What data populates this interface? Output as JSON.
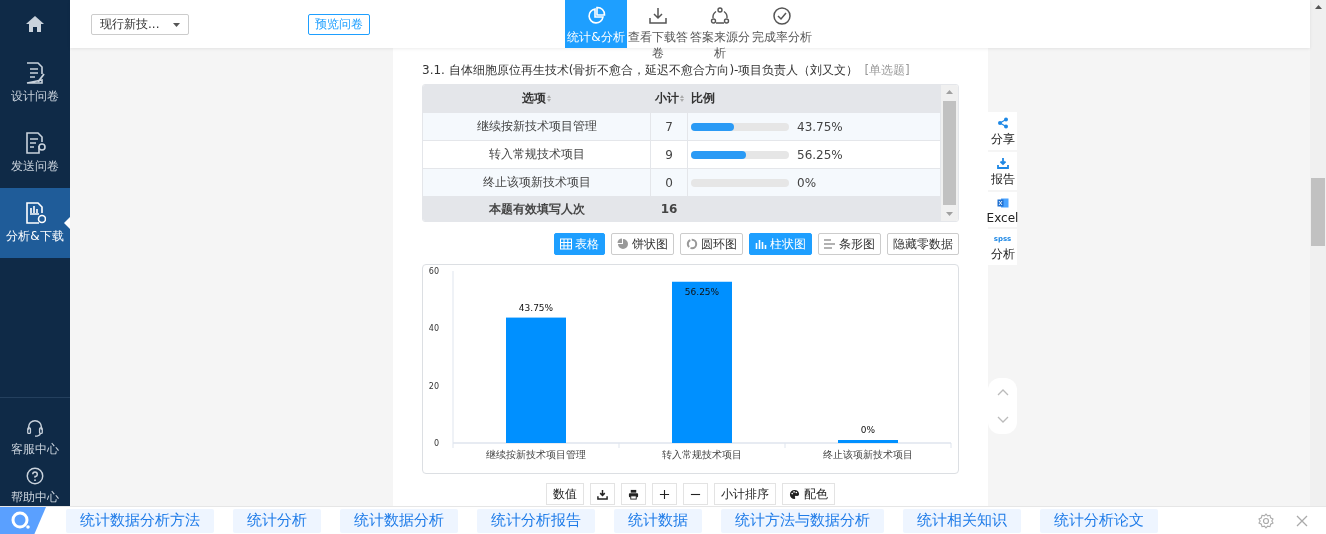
{
  "sidebar": {
    "items": [
      {
        "kind": "home",
        "selected": false
      },
      {
        "kind": "design",
        "label": "设计问卷",
        "selected": false
      },
      {
        "kind": "send",
        "label": "发送问卷",
        "selected": false
      },
      {
        "kind": "analysis",
        "label": "分析&下载",
        "selected": true
      }
    ],
    "bottom_items": [
      {
        "kind": "service",
        "label": "客服中心"
      },
      {
        "kind": "help",
        "label": "帮助中心"
      }
    ]
  },
  "header": {
    "survey_select": {
      "value": "现行新技..."
    },
    "preview_button": "预览问卷",
    "tabs": [
      {
        "kind": "stats",
        "label": "统计&分析",
        "selected": true
      },
      {
        "kind": "download",
        "label": "查看下载答卷",
        "selected": false
      },
      {
        "kind": "source",
        "label": "答案来源分析",
        "selected": false
      },
      {
        "kind": "completion",
        "label": "完成率分析",
        "selected": false
      }
    ]
  },
  "question": {
    "title": "3.1. 自体细胞原位再生技术(骨折不愈合，延迟不愈合方向)-项目负责人（刘又文）",
    "type": "[单选题]",
    "table": {
      "columns": [
        "选项",
        "小计",
        "比例"
      ],
      "rows": [
        {
          "option": "继续按新技术项目管理",
          "count": "7",
          "level": 0.4375,
          "percent": "43.75%"
        },
        {
          "option": "转入常规技术项目",
          "count": "9",
          "level": 0.5625,
          "percent": "56.25%"
        },
        {
          "option": "终止该项新技术项目",
          "count": "0",
          "level": 0,
          "percent": "0%"
        }
      ],
      "total": {
        "label": "本题有效填写人次",
        "count": "16"
      }
    },
    "view_buttons": [
      {
        "kind": "table",
        "label": "表格",
        "selected": true
      },
      {
        "kind": "pie",
        "label": "饼状图",
        "selected": false
      },
      {
        "kind": "ring",
        "label": "圆环图",
        "selected": false
      },
      {
        "kind": "bar",
        "label": "柱状图",
        "selected": true
      },
      {
        "kind": "hbar",
        "label": "条形图",
        "selected": false
      },
      {
        "kind": "hide",
        "label": "隐藏零数据",
        "selected": false
      }
    ],
    "chart_data": {
      "type": "bar",
      "categories": [
        "继续按新技术项目管理",
        "转入常规技术项目",
        "终止该项新技术项目"
      ],
      "series": [
        {
          "color": "#0090ff",
          "values": [
            43.75,
            56.25,
            0
          ]
        }
      ],
      "ylim": [
        0,
        60
      ],
      "yticks": [
        0,
        20,
        40,
        60
      ],
      "value_labels": [
        "43.75%",
        "56.25%",
        "0%"
      ]
    },
    "chart_tools": [
      {
        "kind": "text",
        "label": "数值"
      },
      {
        "kind": "download"
      },
      {
        "kind": "print"
      },
      {
        "kind": "plus"
      },
      {
        "kind": "minus"
      },
      {
        "kind": "text",
        "label": "小计排序"
      },
      {
        "kind": "palette",
        "label": "配色"
      }
    ]
  },
  "side_tools": [
    {
      "kind": "share",
      "label": "分享"
    },
    {
      "kind": "download",
      "label": "报告"
    },
    {
      "kind": "excel",
      "label": "Excel"
    },
    {
      "kind": "spss",
      "badge": "spss",
      "label": "分析"
    }
  ],
  "bottom_bar": {
    "tags": [
      "统计数据分析方法",
      "统计分析",
      "统计数据分析",
      "统计分析报告",
      "统计数据",
      "统计方法与数据分析",
      "统计相关知识",
      "统计分析论文"
    ]
  }
}
